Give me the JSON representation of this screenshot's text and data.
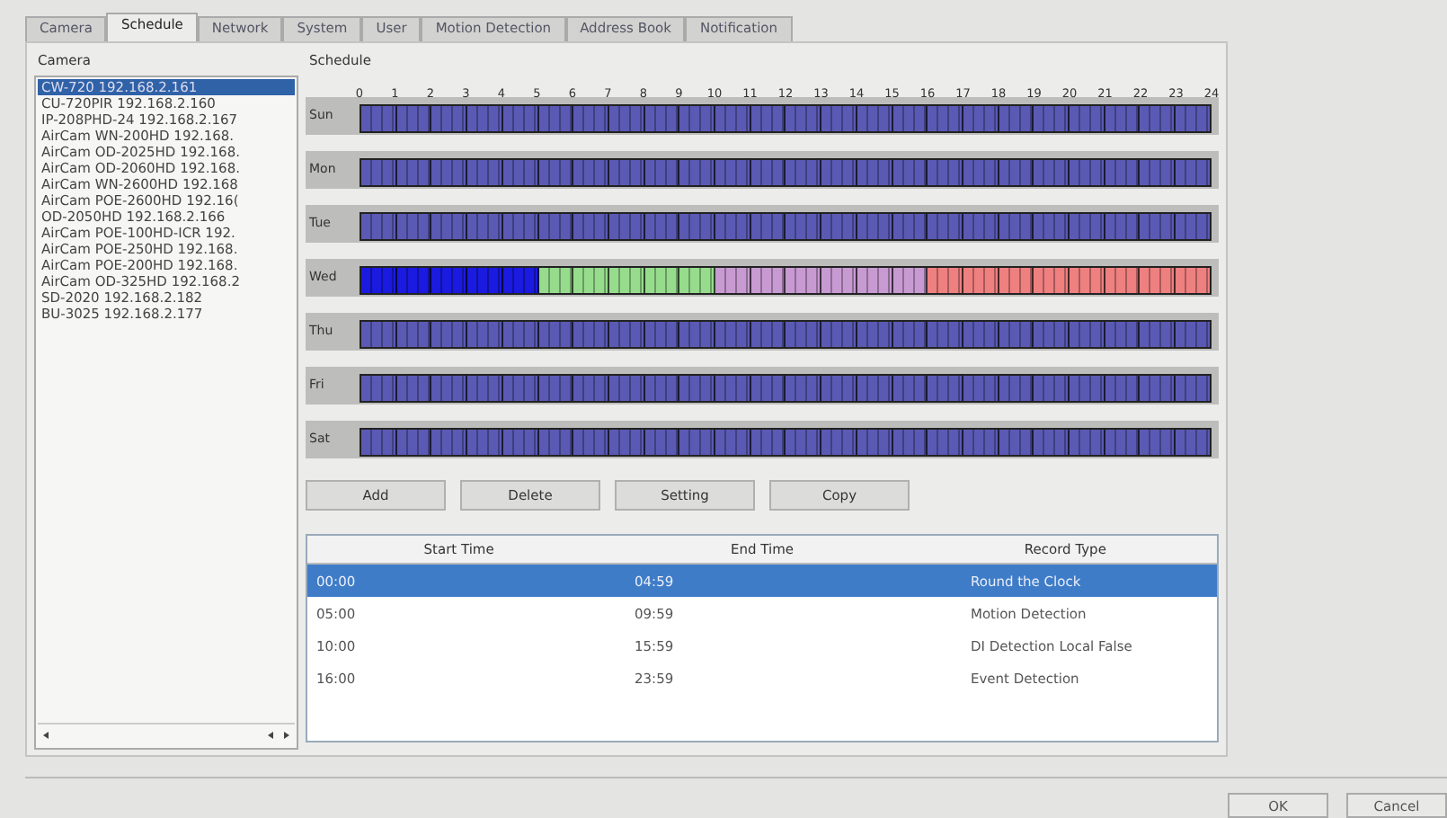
{
  "tabs": [
    {
      "label": "Camera",
      "selected": false
    },
    {
      "label": "Schedule",
      "selected": true
    },
    {
      "label": "Network",
      "selected": false
    },
    {
      "label": "System",
      "selected": false
    },
    {
      "label": "User",
      "selected": false
    },
    {
      "label": "Motion Detection",
      "selected": false
    },
    {
      "label": "Address Book",
      "selected": false
    },
    {
      "label": "Notification",
      "selected": false
    }
  ],
  "camera_panel": {
    "title": "Camera",
    "items": [
      {
        "label": "CW-720 192.168.2.161",
        "selected": true
      },
      {
        "label": "CU-720PIR 192.168.2.160",
        "selected": false
      },
      {
        "label": "IP-208PHD-24 192.168.2.167",
        "selected": false
      },
      {
        "label": "AirCam WN-200HD 192.168.",
        "selected": false
      },
      {
        "label": "AirCam OD-2025HD 192.168.",
        "selected": false
      },
      {
        "label": "AirCam OD-2060HD 192.168.",
        "selected": false
      },
      {
        "label": "AirCam WN-2600HD 192.168",
        "selected": false
      },
      {
        "label": "AirCam POE-2600HD 192.16(",
        "selected": false
      },
      {
        "label": "OD-2050HD 192.168.2.166",
        "selected": false
      },
      {
        "label": "AirCam POE-100HD-ICR 192.",
        "selected": false
      },
      {
        "label": "AirCam POE-250HD 192.168.",
        "selected": false
      },
      {
        "label": "AirCam POE-200HD 192.168.",
        "selected": false
      },
      {
        "label": "AirCam OD-325HD 192.168.2",
        "selected": false
      },
      {
        "label": "SD-2020 192.168.2.182",
        "selected": false
      },
      {
        "label": "BU-3025 192.168.2.177",
        "selected": false
      }
    ]
  },
  "schedule": {
    "title": "Schedule",
    "hour_labels": [
      "0",
      "1",
      "2",
      "3",
      "4",
      "5",
      "6",
      "7",
      "8",
      "9",
      "10",
      "11",
      "12",
      "13",
      "14",
      "15",
      "16",
      "17",
      "18",
      "19",
      "20",
      "21",
      "22",
      "23",
      "24"
    ],
    "days": [
      {
        "label": "Sun",
        "hours": [
          {
            "color": "#5a5ab4"
          },
          {
            "color": "#5a5ab4"
          },
          {
            "color": "#5a5ab4"
          },
          {
            "color": "#5a5ab4"
          },
          {
            "color": "#5a5ab4"
          },
          {
            "color": "#5a5ab4"
          },
          {
            "color": "#5a5ab4"
          },
          {
            "color": "#5a5ab4"
          },
          {
            "color": "#5a5ab4"
          },
          {
            "color": "#5a5ab4"
          },
          {
            "color": "#5a5ab4"
          },
          {
            "color": "#5a5ab4"
          },
          {
            "color": "#5a5ab4"
          },
          {
            "color": "#5a5ab4"
          },
          {
            "color": "#5a5ab4"
          },
          {
            "color": "#5a5ab4"
          },
          {
            "color": "#5a5ab4"
          },
          {
            "color": "#5a5ab4"
          },
          {
            "color": "#5a5ab4"
          },
          {
            "color": "#5a5ab4"
          },
          {
            "color": "#5a5ab4"
          },
          {
            "color": "#5a5ab4"
          },
          {
            "color": "#5a5ab4"
          },
          {
            "color": "#5a5ab4"
          }
        ]
      },
      {
        "label": "Mon",
        "hours": [
          {
            "color": "#5a5ab4"
          },
          {
            "color": "#5a5ab4"
          },
          {
            "color": "#5a5ab4"
          },
          {
            "color": "#5a5ab4"
          },
          {
            "color": "#5a5ab4"
          },
          {
            "color": "#5a5ab4"
          },
          {
            "color": "#5a5ab4"
          },
          {
            "color": "#5a5ab4"
          },
          {
            "color": "#5a5ab4"
          },
          {
            "color": "#5a5ab4"
          },
          {
            "color": "#5a5ab4"
          },
          {
            "color": "#5a5ab4"
          },
          {
            "color": "#5a5ab4"
          },
          {
            "color": "#5a5ab4"
          },
          {
            "color": "#5a5ab4"
          },
          {
            "color": "#5a5ab4"
          },
          {
            "color": "#5a5ab4"
          },
          {
            "color": "#5a5ab4"
          },
          {
            "color": "#5a5ab4"
          },
          {
            "color": "#5a5ab4"
          },
          {
            "color": "#5a5ab4"
          },
          {
            "color": "#5a5ab4"
          },
          {
            "color": "#5a5ab4"
          },
          {
            "color": "#5a5ab4"
          }
        ]
      },
      {
        "label": "Tue",
        "hours": [
          {
            "color": "#5a5ab4"
          },
          {
            "color": "#5a5ab4"
          },
          {
            "color": "#5a5ab4"
          },
          {
            "color": "#5a5ab4"
          },
          {
            "color": "#5a5ab4"
          },
          {
            "color": "#5a5ab4"
          },
          {
            "color": "#5a5ab4"
          },
          {
            "color": "#5a5ab4"
          },
          {
            "color": "#5a5ab4"
          },
          {
            "color": "#5a5ab4"
          },
          {
            "color": "#5a5ab4"
          },
          {
            "color": "#5a5ab4"
          },
          {
            "color": "#5a5ab4"
          },
          {
            "color": "#5a5ab4"
          },
          {
            "color": "#5a5ab4"
          },
          {
            "color": "#5a5ab4"
          },
          {
            "color": "#5a5ab4"
          },
          {
            "color": "#5a5ab4"
          },
          {
            "color": "#5a5ab4"
          },
          {
            "color": "#5a5ab4"
          },
          {
            "color": "#5a5ab4"
          },
          {
            "color": "#5a5ab4"
          },
          {
            "color": "#5a5ab4"
          },
          {
            "color": "#5a5ab4"
          }
        ]
      },
      {
        "label": "Wed",
        "hours": [
          {
            "color": "#1a1ae0"
          },
          {
            "color": "#1a1ae0"
          },
          {
            "color": "#1a1ae0"
          },
          {
            "color": "#1a1ae0"
          },
          {
            "color": "#1a1ae0"
          },
          {
            "color": "#96dc8c"
          },
          {
            "color": "#96dc8c"
          },
          {
            "color": "#96dc8c"
          },
          {
            "color": "#96dc8c"
          },
          {
            "color": "#96dc8c"
          },
          {
            "color": "#c89ad2"
          },
          {
            "color": "#c89ad2"
          },
          {
            "color": "#c89ad2"
          },
          {
            "color": "#c89ad2"
          },
          {
            "color": "#c89ad2"
          },
          {
            "color": "#c89ad2"
          },
          {
            "color": "#ee8080"
          },
          {
            "color": "#ee8080"
          },
          {
            "color": "#ee8080"
          },
          {
            "color": "#ee8080"
          },
          {
            "color": "#ee8080"
          },
          {
            "color": "#ee8080"
          },
          {
            "color": "#ee8080"
          },
          {
            "color": "#ee8080"
          }
        ]
      },
      {
        "label": "Thu",
        "hours": [
          {
            "color": "#5a5ab4"
          },
          {
            "color": "#5a5ab4"
          },
          {
            "color": "#5a5ab4"
          },
          {
            "color": "#5a5ab4"
          },
          {
            "color": "#5a5ab4"
          },
          {
            "color": "#5a5ab4"
          },
          {
            "color": "#5a5ab4"
          },
          {
            "color": "#5a5ab4"
          },
          {
            "color": "#5a5ab4"
          },
          {
            "color": "#5a5ab4"
          },
          {
            "color": "#5a5ab4"
          },
          {
            "color": "#5a5ab4"
          },
          {
            "color": "#5a5ab4"
          },
          {
            "color": "#5a5ab4"
          },
          {
            "color": "#5a5ab4"
          },
          {
            "color": "#5a5ab4"
          },
          {
            "color": "#5a5ab4"
          },
          {
            "color": "#5a5ab4"
          },
          {
            "color": "#5a5ab4"
          },
          {
            "color": "#5a5ab4"
          },
          {
            "color": "#5a5ab4"
          },
          {
            "color": "#5a5ab4"
          },
          {
            "color": "#5a5ab4"
          },
          {
            "color": "#5a5ab4"
          }
        ]
      },
      {
        "label": "Fri",
        "hours": [
          {
            "color": "#5a5ab4"
          },
          {
            "color": "#5a5ab4"
          },
          {
            "color": "#5a5ab4"
          },
          {
            "color": "#5a5ab4"
          },
          {
            "color": "#5a5ab4"
          },
          {
            "color": "#5a5ab4"
          },
          {
            "color": "#5a5ab4"
          },
          {
            "color": "#5a5ab4"
          },
          {
            "color": "#5a5ab4"
          },
          {
            "color": "#5a5ab4"
          },
          {
            "color": "#5a5ab4"
          },
          {
            "color": "#5a5ab4"
          },
          {
            "color": "#5a5ab4"
          },
          {
            "color": "#5a5ab4"
          },
          {
            "color": "#5a5ab4"
          },
          {
            "color": "#5a5ab4"
          },
          {
            "color": "#5a5ab4"
          },
          {
            "color": "#5a5ab4"
          },
          {
            "color": "#5a5ab4"
          },
          {
            "color": "#5a5ab4"
          },
          {
            "color": "#5a5ab4"
          },
          {
            "color": "#5a5ab4"
          },
          {
            "color": "#5a5ab4"
          },
          {
            "color": "#5a5ab4"
          }
        ]
      },
      {
        "label": "Sat",
        "hours": [
          {
            "color": "#5a5ab4"
          },
          {
            "color": "#5a5ab4"
          },
          {
            "color": "#5a5ab4"
          },
          {
            "color": "#5a5ab4"
          },
          {
            "color": "#5a5ab4"
          },
          {
            "color": "#5a5ab4"
          },
          {
            "color": "#5a5ab4"
          },
          {
            "color": "#5a5ab4"
          },
          {
            "color": "#5a5ab4"
          },
          {
            "color": "#5a5ab4"
          },
          {
            "color": "#5a5ab4"
          },
          {
            "color": "#5a5ab4"
          },
          {
            "color": "#5a5ab4"
          },
          {
            "color": "#5a5ab4"
          },
          {
            "color": "#5a5ab4"
          },
          {
            "color": "#5a5ab4"
          },
          {
            "color": "#5a5ab4"
          },
          {
            "color": "#5a5ab4"
          },
          {
            "color": "#5a5ab4"
          },
          {
            "color": "#5a5ab4"
          },
          {
            "color": "#5a5ab4"
          },
          {
            "color": "#5a5ab4"
          },
          {
            "color": "#5a5ab4"
          },
          {
            "color": "#5a5ab4"
          }
        ]
      }
    ]
  },
  "buttons": [
    "Add",
    "Delete",
    "Setting",
    "Copy"
  ],
  "table": {
    "columns": [
      "Start Time",
      "End Time",
      "Record Type"
    ],
    "rows": [
      {
        "cells": [
          "00:00",
          "04:59",
          "Round the Clock"
        ],
        "selected": true
      },
      {
        "cells": [
          "05:00",
          "09:59",
          "Motion Detection"
        ],
        "selected": false
      },
      {
        "cells": [
          "10:00",
          "15:59",
          "DI Detection Local False"
        ],
        "selected": false
      },
      {
        "cells": [
          "16:00",
          "23:59",
          "Event Detection"
        ],
        "selected": false
      }
    ]
  },
  "footer_buttons": [
    "OK",
    "Cancel"
  ]
}
